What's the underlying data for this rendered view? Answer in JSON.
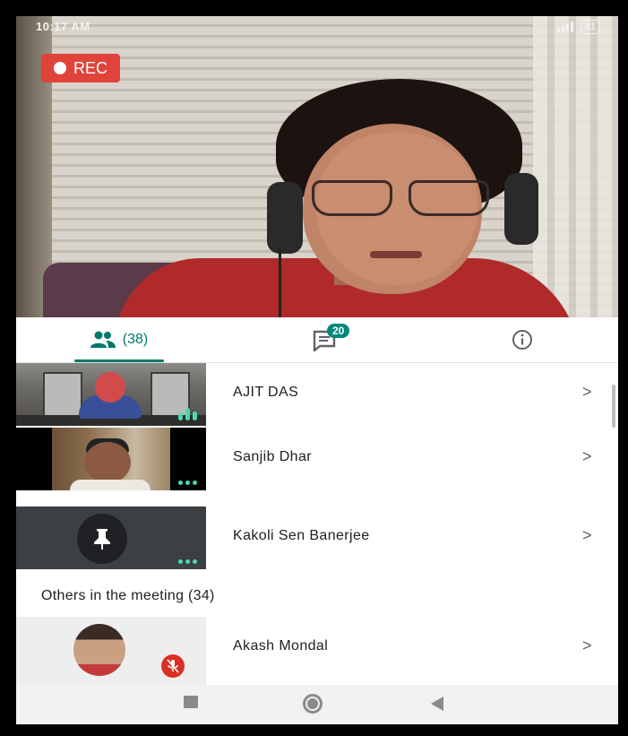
{
  "status_bar": {
    "time": "10:17 AM",
    "battery": "81"
  },
  "recording": {
    "label": "REC"
  },
  "tabs": {
    "people_count": "(38)",
    "chat_badge": "20"
  },
  "participants": [
    {
      "name": "AJIT DAS",
      "audio": "speaking"
    },
    {
      "name": "Sanjib Dhar",
      "audio": "active"
    },
    {
      "name": "Kakoli Sen Banerjee",
      "audio": "active"
    }
  ],
  "others": {
    "title": "Others in the meeting (34)",
    "items": [
      {
        "name": "Akash Mondal",
        "muted": true
      }
    ]
  },
  "chevron": ">",
  "colors": {
    "accent": "#00796b",
    "rec": "#e0433a",
    "audio_indicator": "#4cd7b4",
    "mute": "#d93025"
  },
  "icons": [
    "people-icon",
    "chat-icon",
    "info-icon",
    "pin-icon",
    "mic-off-icon",
    "recents-icon",
    "home-icon",
    "back-icon"
  ]
}
